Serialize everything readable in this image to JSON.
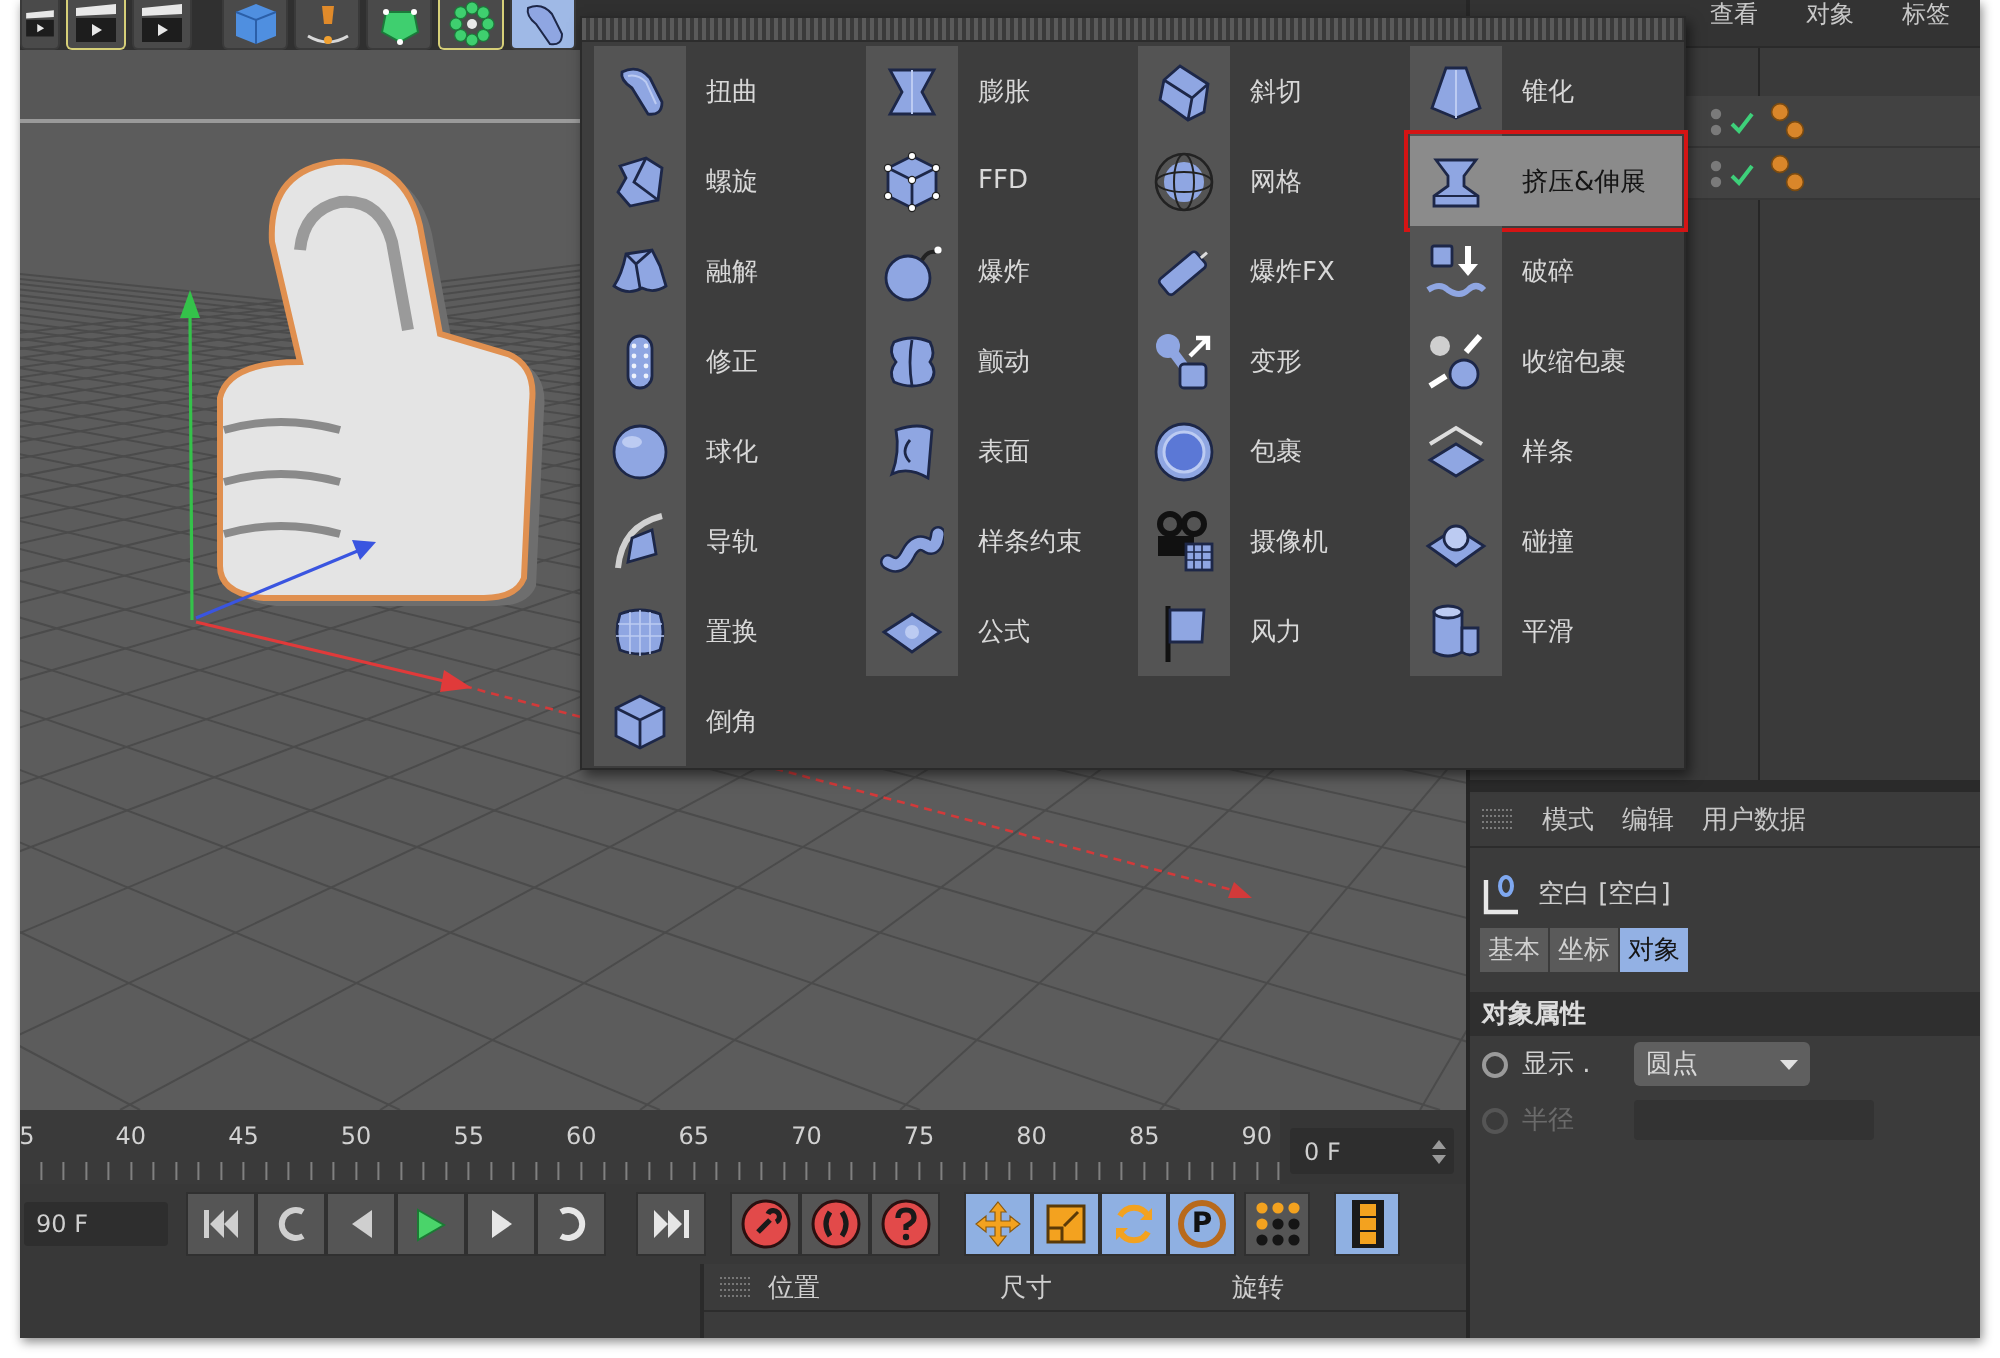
{
  "toolbar": {
    "groups": [
      [
        {
          "selected": false,
          "outlined": false
        },
        {
          "selected": false,
          "outlined": true
        },
        {
          "selected": false,
          "outlined": false
        }
      ],
      [
        {
          "selected": false,
          "outlined": false
        },
        {
          "selected": false,
          "outlined": false
        },
        {
          "selected": false,
          "outlined": false
        },
        {
          "selected": false,
          "outlined": true
        },
        {
          "selected": true,
          "outlined": false
        }
      ]
    ]
  },
  "deformer_menu": {
    "columns": [
      [
        {
          "label": "扭曲",
          "selected": false
        },
        {
          "label": "螺旋",
          "selected": false
        },
        {
          "label": "融解",
          "selected": false
        },
        {
          "label": "修正",
          "selected": false
        },
        {
          "label": "球化",
          "selected": false
        },
        {
          "label": "导轨",
          "selected": false
        },
        {
          "label": "置换",
          "selected": false
        },
        {
          "label": "倒角",
          "selected": false
        }
      ],
      [
        {
          "label": "膨胀",
          "selected": false
        },
        {
          "label": "FFD",
          "selected": false
        },
        {
          "label": "爆炸",
          "selected": false
        },
        {
          "label": "颤动",
          "selected": false
        },
        {
          "label": "表面",
          "selected": false
        },
        {
          "label": "样条约束",
          "selected": false
        },
        {
          "label": "公式",
          "selected": false
        }
      ],
      [
        {
          "label": "斜切",
          "selected": false
        },
        {
          "label": "网格",
          "selected": false
        },
        {
          "label": "爆炸FX",
          "selected": false
        },
        {
          "label": "变形",
          "selected": false
        },
        {
          "label": "包裹",
          "selected": false
        },
        {
          "label": "摄像机",
          "selected": false
        },
        {
          "label": "风力",
          "selected": false
        }
      ],
      [
        {
          "label": "锥化",
          "selected": false
        },
        {
          "label": "挤压&伸展",
          "selected": true
        },
        {
          "label": "破碎",
          "selected": false
        },
        {
          "label": "收缩包裹",
          "selected": false
        },
        {
          "label": "样条",
          "selected": false
        },
        {
          "label": "碰撞",
          "selected": false
        },
        {
          "label": "平滑",
          "selected": false
        }
      ]
    ]
  },
  "object_manager": {
    "menu": [
      "查看",
      "对象",
      "标签"
    ],
    "objects": [
      {
        "checked": true
      },
      {
        "checked": true
      }
    ]
  },
  "attribute_manager": {
    "menu": [
      "模式",
      "编辑",
      "用户数据"
    ],
    "object": "空白 [空白]",
    "tabs": [
      {
        "label": "基本",
        "selected": false
      },
      {
        "label": "坐标",
        "selected": false
      },
      {
        "label": "对象",
        "selected": true
      }
    ],
    "section": "对象属性",
    "fields": [
      {
        "kind": "dropdown",
        "label": "显示 .",
        "value": "圆点",
        "disabled": false,
        "keyed": false
      },
      {
        "kind": "number",
        "label": "半径",
        "disabled": true,
        "keyed": false
      }
    ]
  },
  "timeline": {
    "ruler": [
      "5",
      "40",
      "45",
      "50",
      "55",
      "60",
      "65",
      "70",
      "75",
      "80",
      "85",
      "90"
    ],
    "current_frame": "0 F"
  },
  "transport": {
    "end_frame": "90 F",
    "toggles": [
      {
        "on": true
      },
      {
        "on": true
      },
      {
        "on": true
      },
      {
        "on": true,
        "label": "P"
      },
      {
        "on": false
      },
      {
        "on": true
      }
    ]
  },
  "coordinates": {
    "columns": [
      "位置",
      "尺寸",
      "旋转"
    ]
  }
}
